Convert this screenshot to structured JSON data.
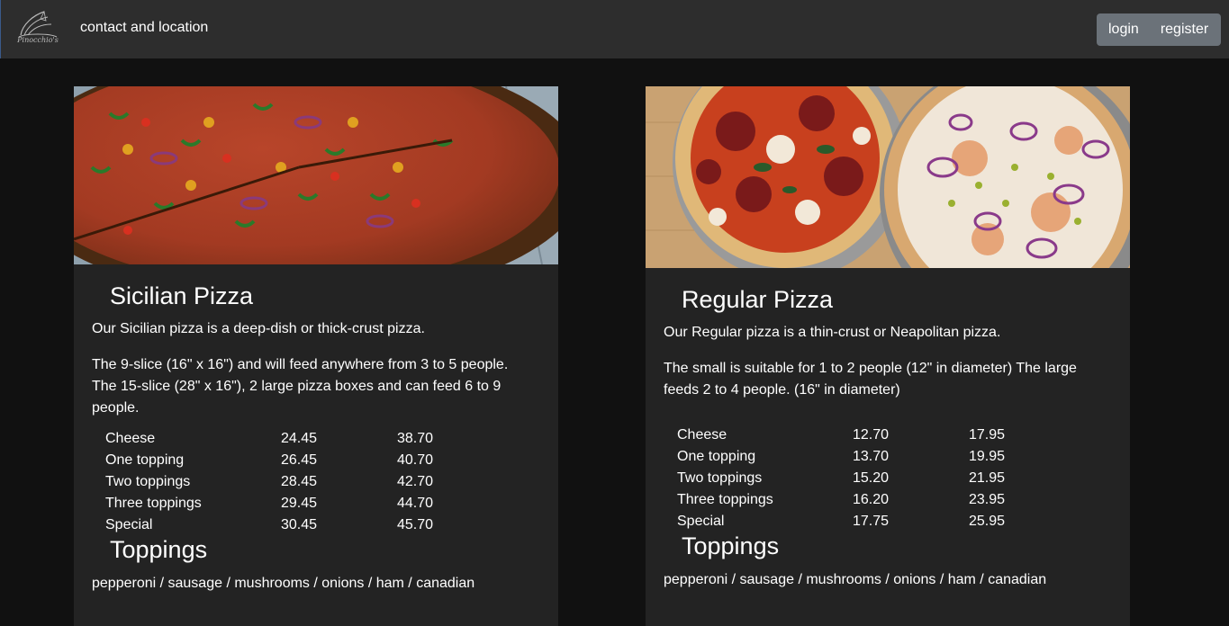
{
  "nav": {
    "logo_text": "Pinocchio's",
    "contact_link": "contact and location",
    "login_label": "login",
    "register_label": "register"
  },
  "sicilian": {
    "title": "Sicilian Pizza",
    "description": "Our Sicilian pizza is a deep-dish or thick-crust pizza.",
    "sizes": "The 9-slice (16\" x 16\") and will feed anywhere from 3 to 5 people. The 15-slice (28\" x 16\"), 2 large pizza boxes and can feed 6 to 9 people.",
    "prices": [
      {
        "name": "Cheese",
        "small": "24.45",
        "large": "38.70"
      },
      {
        "name": "One topping",
        "small": "26.45",
        "large": "40.70"
      },
      {
        "name": "Two toppings",
        "small": "28.45",
        "large": "42.70"
      },
      {
        "name": "Three toppings",
        "small": "29.45",
        "large": "44.70"
      },
      {
        "name": "Special",
        "small": "30.45",
        "large": "45.70"
      }
    ],
    "toppings_title": "Toppings",
    "toppings_text": "pepperoni / sausage / mushrooms / onions / ham / canadian"
  },
  "regular": {
    "title": "Regular Pizza",
    "description": "Our Regular pizza is a thin-crust or Neapolitan pizza.",
    "sizes": "The small is suitable for 1 to 2 people (12\" in diameter) The large feeds 2 to 4 people. (16\" in diameter)",
    "prices": [
      {
        "name": "Cheese",
        "small": "12.70",
        "large": "17.95"
      },
      {
        "name": "One topping",
        "small": "13.70",
        "large": "19.95"
      },
      {
        "name": "Two toppings",
        "small": "15.20",
        "large": "21.95"
      },
      {
        "name": "Three toppings",
        "small": "16.20",
        "large": "23.95"
      },
      {
        "name": "Special",
        "small": "17.75",
        "large": "25.95"
      }
    ],
    "toppings_title": "Toppings",
    "toppings_text": "pepperoni / sausage / mushrooms / onions / ham / canadian"
  }
}
